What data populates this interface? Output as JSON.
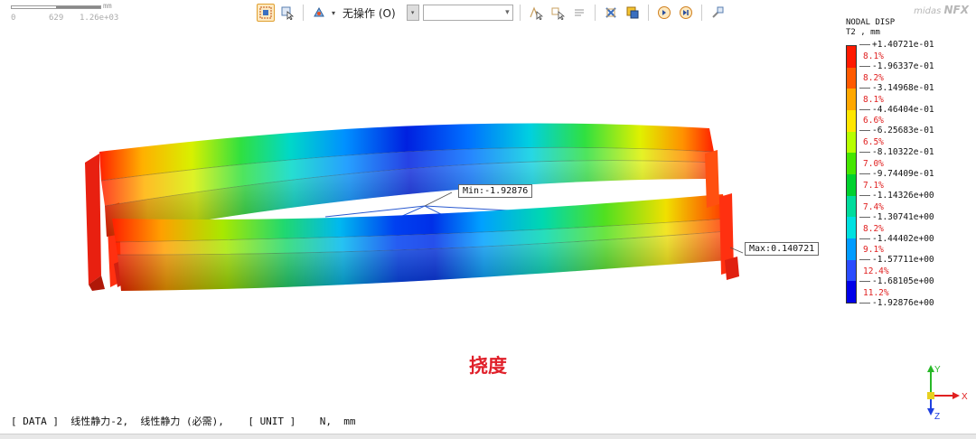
{
  "scale": {
    "unit": "mm",
    "ticks": [
      "0",
      "629",
      "1.26e+03"
    ]
  },
  "toolbar": {
    "operation_label": "无操作 (O)",
    "combo_value": ""
  },
  "brand": {
    "prefix": "midas",
    "name": "NFX"
  },
  "legend": {
    "title": "NODAL DISP\nT2 , mm",
    "colors": [
      "#ff1a00",
      "#ff5a00",
      "#ffa800",
      "#ffe600",
      "#b6ff00",
      "#45e600",
      "#00d12e",
      "#00dc9c",
      "#00e0e0",
      "#009cff",
      "#2a4cff",
      "#0000e8"
    ],
    "values": [
      "+1.40721e-01",
      "-1.96337e-01",
      "-3.14968e-01",
      "-4.46404e-01",
      "-6.25683e-01",
      "-8.10322e-01",
      "-9.74409e-01",
      "-1.14326e+00",
      "-1.30741e+00",
      "-1.44402e+00",
      "-1.57711e+00",
      "-1.68105e+00",
      "-1.92876e+00"
    ],
    "percents": [
      "8.1%",
      "8.2%",
      "8.1%",
      "6.6%",
      "6.5%",
      "7.0%",
      "7.1%",
      "7.4%",
      "8.2%",
      "9.1%",
      "12.4%",
      "11.2%"
    ]
  },
  "callouts": {
    "min": "Min:-1.92876",
    "max": "Max:0.140721"
  },
  "caption": "挠度",
  "status": {
    "text": "[ DATA ]  线性静力-2,  线性静力 (必需),    [ UNIT ]    N,  mm"
  },
  "triad": {
    "x": "X",
    "y": "Y",
    "z": "Z"
  }
}
